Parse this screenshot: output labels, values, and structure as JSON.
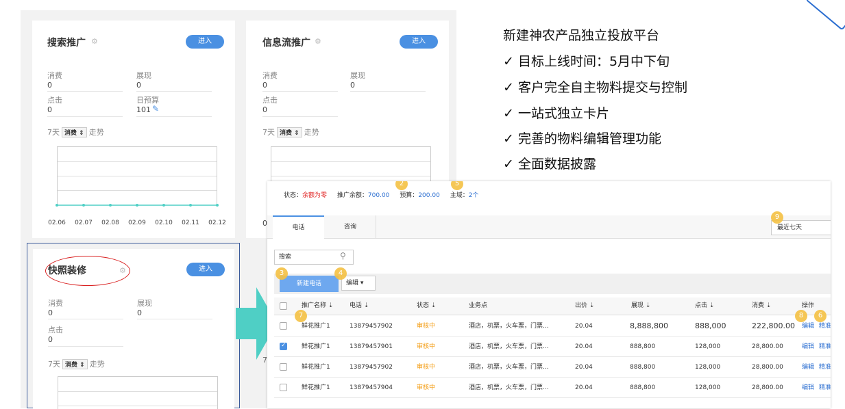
{
  "cards": {
    "search": {
      "title": "搜索推广",
      "enter": "进入",
      "labels": {
        "spend": "消费",
        "impressions": "展现",
        "clicks": "点击",
        "budget": "日预算"
      },
      "values": {
        "spend": "0",
        "impressions": "0",
        "clicks": "0",
        "budget": "101"
      },
      "trend": {
        "prefix": "7天",
        "select": "消费",
        "suffix": "走势"
      }
    },
    "feed": {
      "title": "信息流推广",
      "enter": "进入",
      "labels": {
        "spend": "消费",
        "impressions": "展现",
        "clicks": "点击"
      },
      "values": {
        "spend": "0",
        "impressions": "0",
        "clicks": "0"
      },
      "trend": {
        "prefix": "7天",
        "select": "消费",
        "suffix": "走势"
      },
      "partial_zero": "0"
    },
    "snapshot": {
      "title": "快照装修",
      "enter": "进入",
      "labels": {
        "spend": "消费",
        "impressions": "展现",
        "clicks": "点击"
      },
      "values": {
        "spend": "0",
        "impressions": "0",
        "clicks": "0"
      },
      "trend": {
        "prefix": "7天",
        "select": "消费",
        "suffix": "走势"
      },
      "partial_seven": "7"
    }
  },
  "chart_data": {
    "type": "line",
    "x": [
      "02.06",
      "02.07",
      "02.08",
      "02.09",
      "02.10",
      "02.11",
      "02.12"
    ],
    "series": [
      {
        "values": [
          0,
          0,
          0,
          0,
          0,
          0,
          0
        ]
      }
    ],
    "title": "",
    "xlabel": "",
    "ylabel": "",
    "grid": true
  },
  "features": {
    "heading": "新建神农产品独立投放平台",
    "items": [
      "✓ 目标上线时间：5月中下旬",
      "✓ 客户完全自主物料提交与控制",
      "✓ 一站式独立卡片",
      "✓ 完善的物料编辑管理功能",
      "✓ 全面数据披露"
    ]
  },
  "popup": {
    "status_label": "状态：",
    "status_value": "余额为零",
    "balance_label": "推广余额：",
    "balance_value": "700.00",
    "budget_label": "预算：",
    "budget_value": "200.00",
    "domain_label": "主域：",
    "domain_value": "2个",
    "tabs": [
      "电话",
      "咨询"
    ],
    "date_range": "最近七天",
    "search_placeholder": "搜索",
    "new_button": "新建电话",
    "edit_button": "编辑",
    "headers": [
      "推广名称",
      "电话",
      "状态",
      "业务点",
      "出价",
      "展现",
      "点击",
      "消费",
      "操作"
    ],
    "rows": [
      {
        "name": "鲜花推广1",
        "phone": "13879457902",
        "status": "审核中",
        "biz": "酒店，机票，火车票，门票...",
        "bid": "20.04",
        "imp": "8,888,800",
        "clicks": "888,000",
        "cost": "222,800.00",
        "checked": false
      },
      {
        "name": "鲜花推广1",
        "phone": "13879457901",
        "status": "审核中",
        "biz": "酒店，机票，火车票，门票...",
        "bid": "20.04",
        "imp": "888,800",
        "clicks": "128,000",
        "cost": "28,800.00",
        "checked": true
      },
      {
        "name": "鲜花推广1",
        "phone": "13879457902",
        "status": "审核中",
        "biz": "酒店，机票，火车票，门票...",
        "bid": "20.04",
        "imp": "888,800",
        "clicks": "128,000",
        "cost": "28,800.00",
        "checked": false
      },
      {
        "name": "鲜花推广1",
        "phone": "13879457904",
        "status": "审核中",
        "biz": "酒店，机票，火车票，门票...",
        "bid": "20.04",
        "imp": "888,800",
        "clicks": "128,000",
        "cost": "28,800.00",
        "checked": false
      }
    ],
    "op_edit": "编辑",
    "op_precise": "精准",
    "badges": [
      "2",
      "5",
      "9",
      "3",
      "4",
      "7",
      "8",
      "6"
    ]
  },
  "colors": {
    "accent": "#4a90e2",
    "arrow": "#4fcfc5",
    "badge": "#f5c144",
    "status": "#f39c12",
    "danger": "#e02020"
  }
}
